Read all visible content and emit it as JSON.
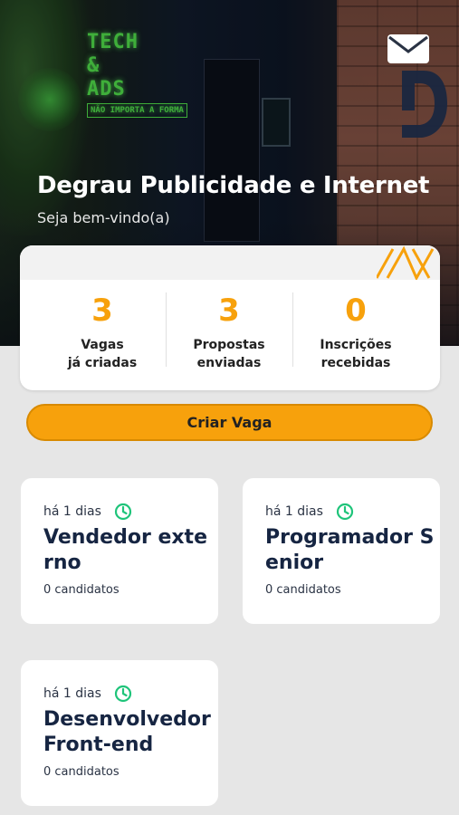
{
  "header": {
    "company_name": "Degrau Publicidade e Internet",
    "welcome": "Seja bem-vindo(a)",
    "mail_icon": "mail-icon",
    "neon_line1": "TECH",
    "neon_line2": "&",
    "neon_line3": "ADS",
    "neon_sub": "NÃO IMPORTA A FORMA"
  },
  "stats": [
    {
      "value": "3",
      "label_line1": "Vagas",
      "label_line2": "já criadas"
    },
    {
      "value": "3",
      "label_line1": "Propostas",
      "label_line2": "enviadas"
    },
    {
      "value": "0",
      "label_line1": "Inscrições",
      "label_line2": "recebidas"
    }
  ],
  "actions": {
    "create_job_label": "Criar Vaga"
  },
  "jobs": [
    {
      "age": "há 1 dias",
      "title": "Vendedor externo",
      "candidates": "0 candidatos"
    },
    {
      "age": "há 1 dias",
      "title": "Programador Senior",
      "candidates": "0 candidatos"
    },
    {
      "age": "há 1 dias",
      "title": "Desenvolvedor Front-end",
      "candidates": "0 candidatos"
    }
  ],
  "colors": {
    "accent": "#f7a10c",
    "title": "#162542",
    "clock": "#1fc47a",
    "background": "#e6e6e6"
  }
}
